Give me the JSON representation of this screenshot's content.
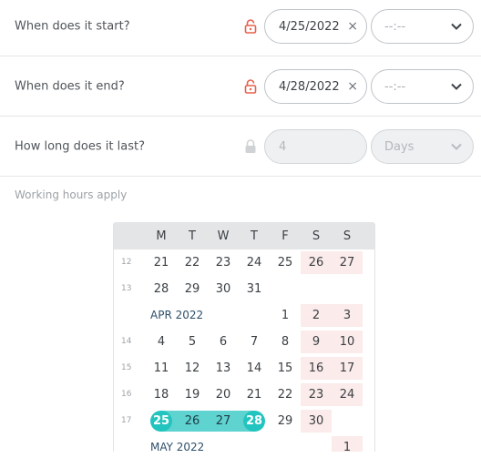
{
  "form": {
    "start": {
      "label": "When does it start?",
      "date": "4/25/2022",
      "clear": "×",
      "time_placeholder": "--:--"
    },
    "end": {
      "label": "When does it end?",
      "date": "4/28/2022",
      "clear": "×",
      "time_placeholder": "--:--"
    },
    "duration": {
      "label": "How long does it last?",
      "value": "4",
      "unit": "Days"
    },
    "note": "Working hours apply"
  },
  "colors": {
    "accent": "#22c4bf",
    "range": "#5fd3cf",
    "lock": "#e8604c",
    "weekend": "#fbebea"
  },
  "calendar": {
    "days_of_week": [
      "M",
      "T",
      "W",
      "T",
      "F",
      "S",
      "S"
    ],
    "rows": [
      {
        "week": "12",
        "days": [
          "21",
          "22",
          "23",
          "24",
          "25",
          "26",
          "27"
        ]
      },
      {
        "week": "13",
        "days": [
          "28",
          "29",
          "30",
          "31",
          "",
          "",
          ""
        ]
      },
      {
        "month": "APR 2022",
        "days": [
          "",
          "",
          "",
          "",
          "1",
          "2",
          "3"
        ]
      },
      {
        "week": "14",
        "days": [
          "4",
          "5",
          "6",
          "7",
          "8",
          "9",
          "10"
        ]
      },
      {
        "week": "15",
        "days": [
          "11",
          "12",
          "13",
          "14",
          "15",
          "16",
          "17"
        ]
      },
      {
        "week": "16",
        "days": [
          "18",
          "19",
          "20",
          "21",
          "22",
          "23",
          "24"
        ]
      },
      {
        "week": "17",
        "days": [
          "25",
          "26",
          "27",
          "28",
          "29",
          "30",
          ""
        ]
      },
      {
        "month": "MAY 2022",
        "days": [
          "",
          "",
          "",
          "",
          "",
          "",
          "1"
        ]
      }
    ],
    "selected_range": {
      "start": "25",
      "end": "28"
    }
  }
}
